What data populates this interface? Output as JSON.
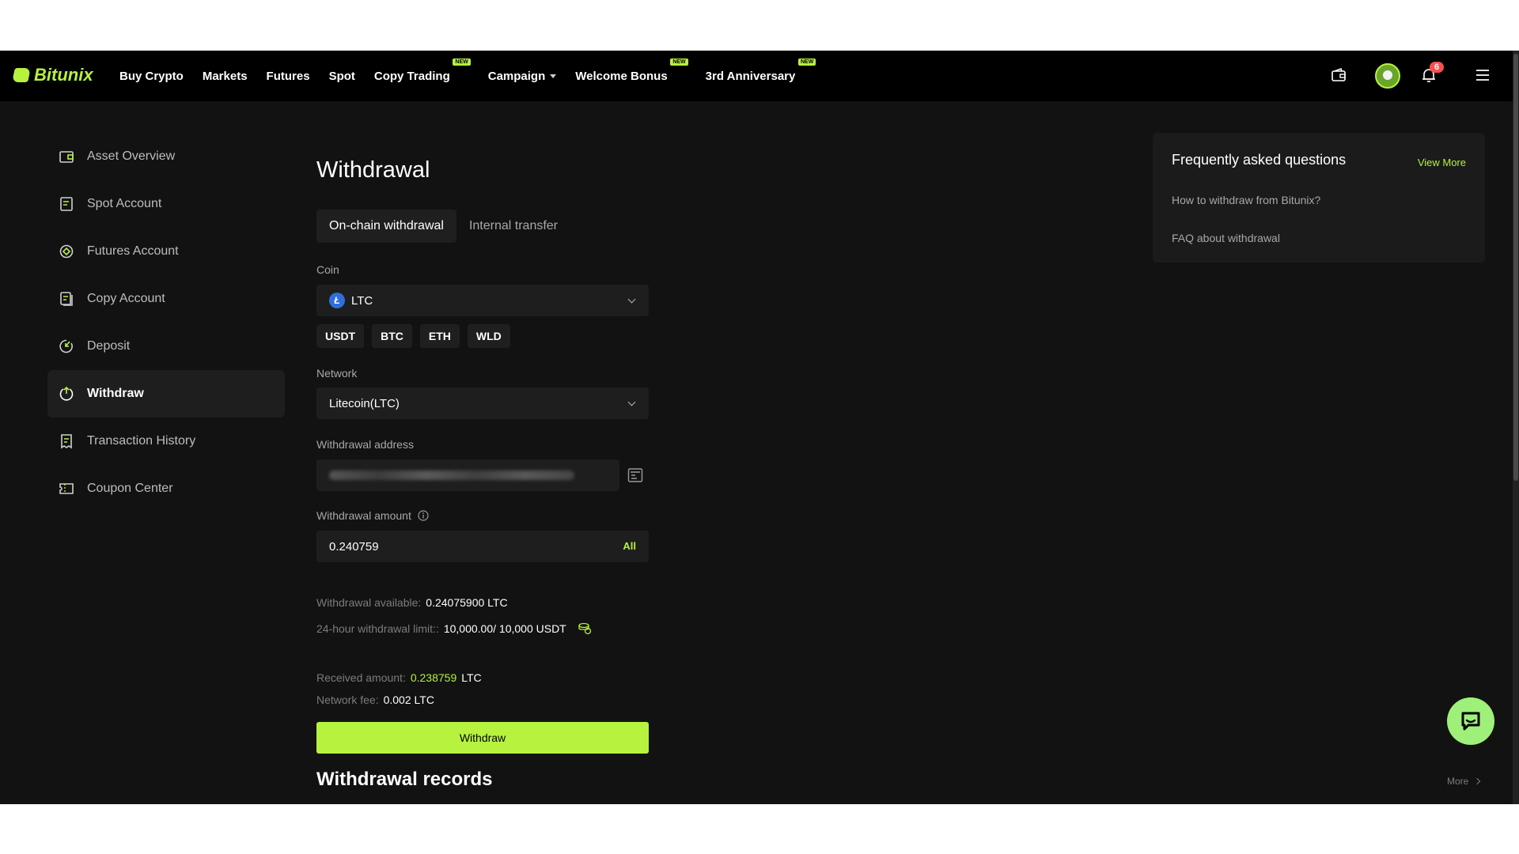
{
  "brand": {
    "name": "Bitunix",
    "accent": "#b6f23e"
  },
  "nav": {
    "items": [
      {
        "label": "Buy Crypto",
        "badge": ""
      },
      {
        "label": "Markets",
        "badge": ""
      },
      {
        "label": "Futures",
        "badge": ""
      },
      {
        "label": "Spot",
        "badge": ""
      },
      {
        "label": "Copy Trading",
        "badge": "NEW"
      },
      {
        "label": "Campaign",
        "badge": ""
      },
      {
        "label": "Welcome Bonus",
        "badge": "NEW"
      },
      {
        "label": "3rd Anniversary",
        "badge": "NEW"
      }
    ],
    "notification_count": "6",
    "icons": [
      "wallet-icon",
      "avatar",
      "bell-icon",
      "menu-icon"
    ]
  },
  "sidebar": {
    "items": [
      {
        "label": "Asset Overview",
        "icon": "wallet-icon"
      },
      {
        "label": "Spot Account",
        "icon": "document-icon"
      },
      {
        "label": "Futures Account",
        "icon": "target-icon"
      },
      {
        "label": "Copy Account",
        "icon": "copy-icon"
      },
      {
        "label": "Deposit",
        "icon": "deposit-icon"
      },
      {
        "label": "Withdraw",
        "icon": "withdraw-icon",
        "active": true
      },
      {
        "label": "Transaction History",
        "icon": "receipt-icon"
      },
      {
        "label": "Coupon Center",
        "icon": "coupon-icon"
      }
    ]
  },
  "main": {
    "title": "Withdrawal",
    "tabs": [
      {
        "label": "On-chain withdrawal",
        "active": true
      },
      {
        "label": "Internal transfer",
        "active": false
      }
    ],
    "coin": {
      "label": "Coin",
      "selected": "LTC",
      "logo_letter": "Ł",
      "quick": [
        "USDT",
        "BTC",
        "ETH",
        "WLD"
      ]
    },
    "network": {
      "label": "Network",
      "selected": "Litecoin(LTC)"
    },
    "address": {
      "label": "Withdrawal address"
    },
    "amount": {
      "label": "Withdrawal amount",
      "value": "0.240759",
      "all_label": "All"
    },
    "available": {
      "label": "Withdrawal available:",
      "value": "0.24075900 LTC"
    },
    "limit": {
      "label": "24-hour withdrawal limit::",
      "value": "10,000.00/ 10,000 USDT"
    },
    "received": {
      "label": "Received amount:",
      "value": "0.238759",
      "unit": "LTC"
    },
    "fee": {
      "label": "Network fee:",
      "value": "0.002 LTC"
    },
    "submit_label": "Withdraw",
    "records_title": "Withdrawal records",
    "records_more": "More"
  },
  "faq": {
    "title": "Frequently asked questions",
    "view_more": "View More",
    "links": [
      "How to withdraw from Bitunix?",
      "FAQ about withdrawal"
    ]
  }
}
